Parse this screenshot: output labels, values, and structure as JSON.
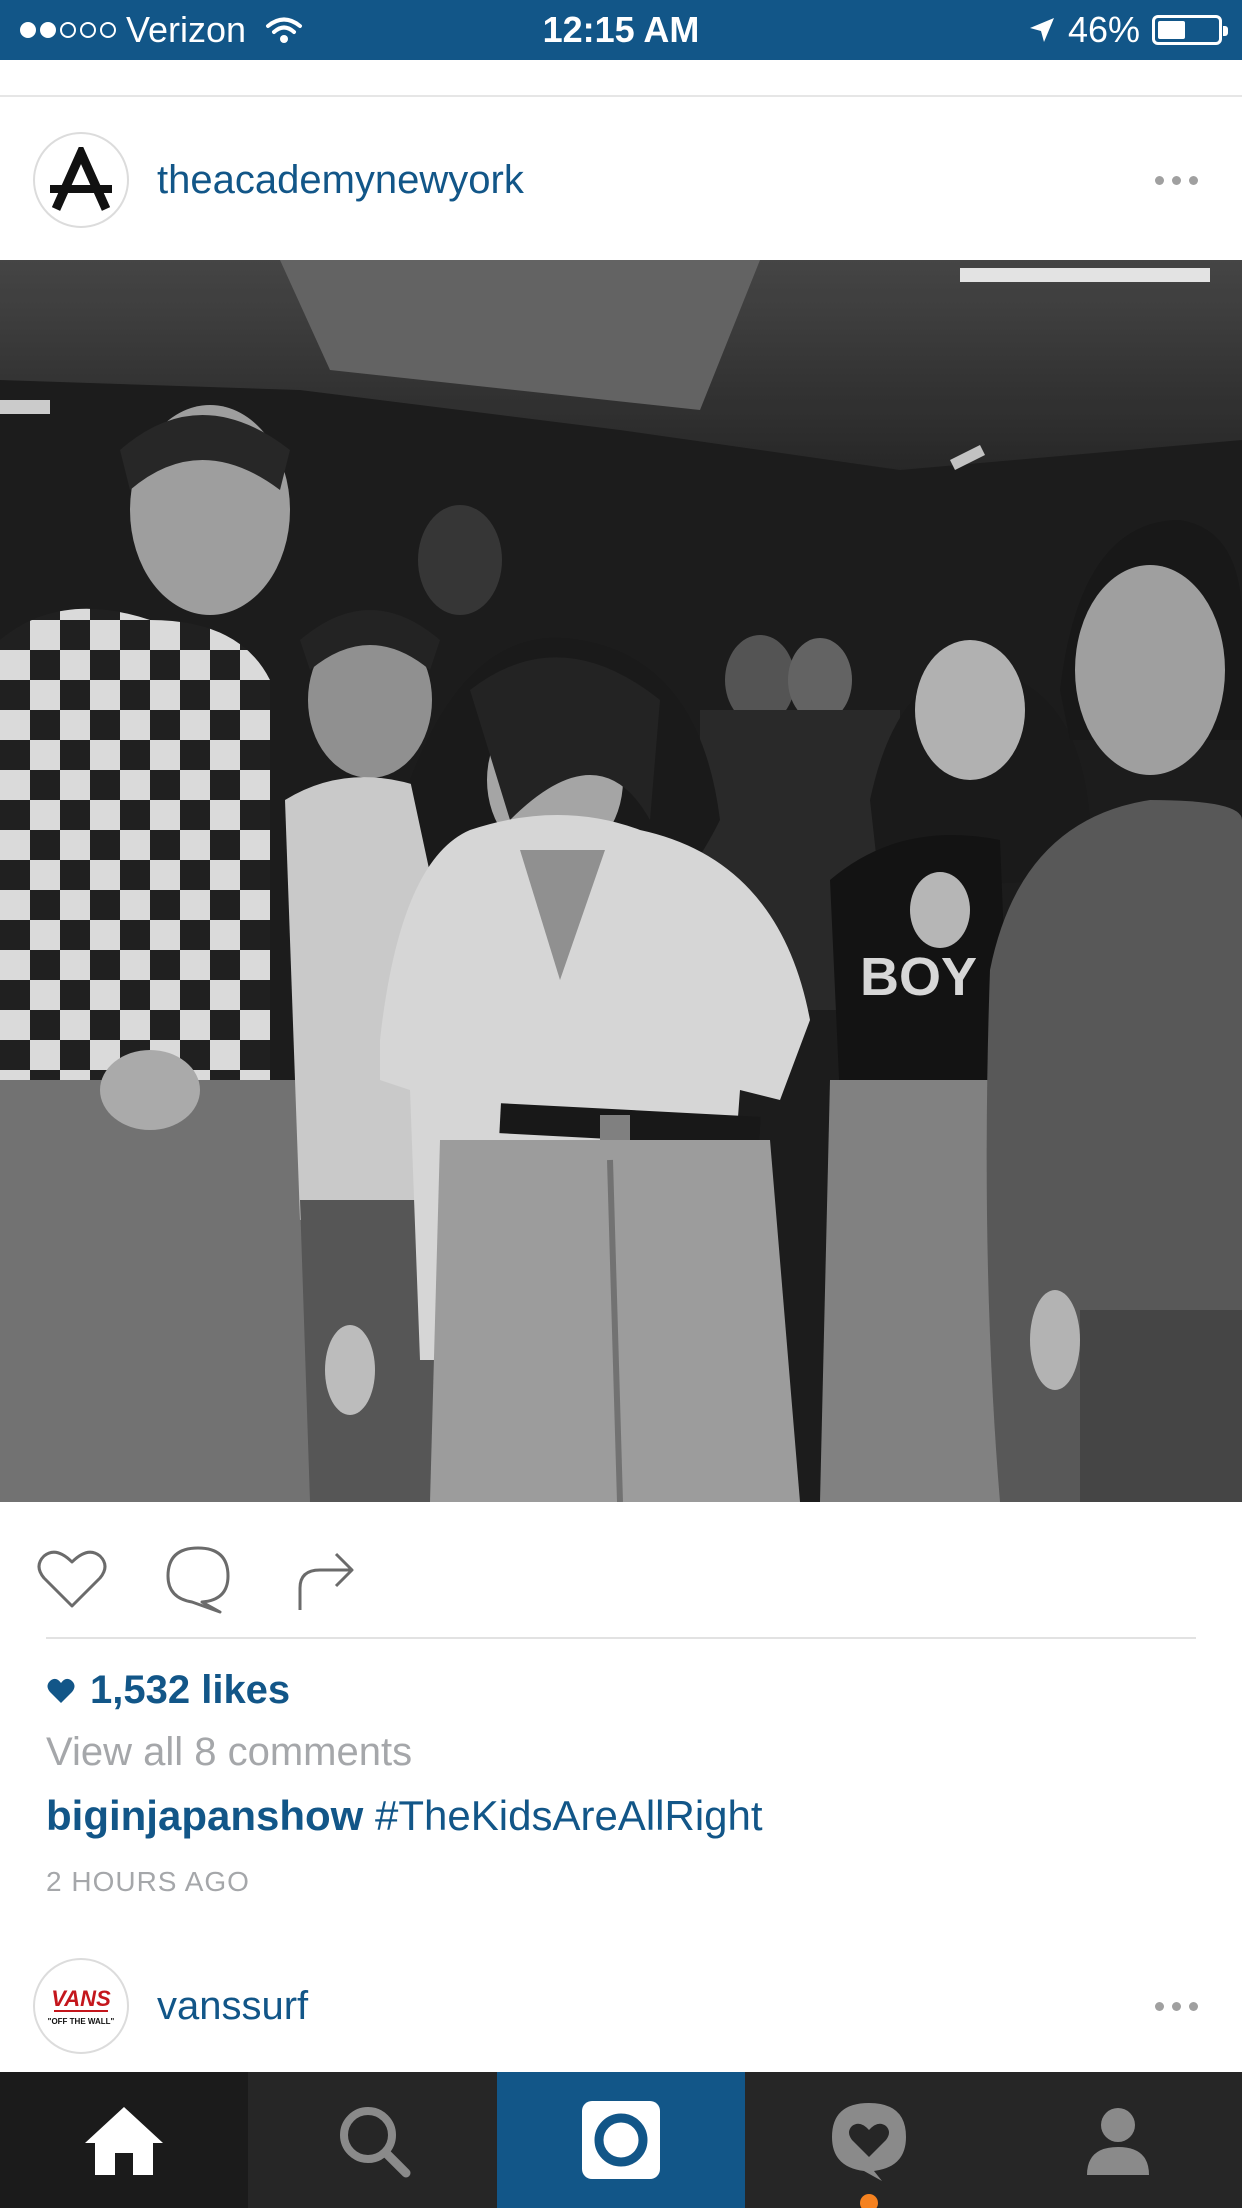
{
  "status_bar": {
    "carrier": "Verizon",
    "time": "12:15 AM",
    "battery_label": "46%",
    "battery_level": 0.46,
    "signal_bars_filled": 2,
    "signal_bars_total": 5
  },
  "posts": [
    {
      "username": "theacademynewyork",
      "avatar_icon": "academy-logo-icon",
      "likes_label": "1,532 likes",
      "comments_link": "View all 8 comments",
      "caption_author": "biginjapanshow",
      "caption_text": "#TheKidsAreAllRight",
      "timestamp": "2 HOURS AGO"
    },
    {
      "username": "vanssurf",
      "avatar_icon": "vans-logo-icon",
      "avatar_text": "VANS",
      "avatar_subtext": "\"OFF THE WALL\""
    }
  ],
  "tabs": [
    {
      "name": "home",
      "icon": "home-icon",
      "active": true
    },
    {
      "name": "search",
      "icon": "search-icon"
    },
    {
      "name": "camera",
      "icon": "camera-icon"
    },
    {
      "name": "activity",
      "icon": "activity-heart-icon",
      "has_notification": true
    },
    {
      "name": "profile",
      "icon": "profile-icon"
    }
  ],
  "colors": {
    "brand_blue": "#125688",
    "tab_bar": "#262626",
    "notification": "#f58220",
    "secondary_text": "#a5a7aa"
  }
}
